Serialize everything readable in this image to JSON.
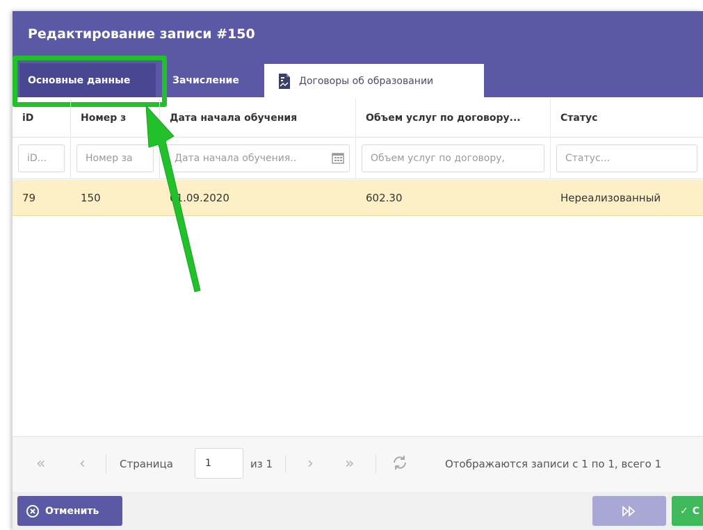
{
  "dialog": {
    "title": "Редактирование записи #150",
    "tabs": {
      "main": "Основные данные",
      "enrollment": "Зачисление",
      "contracts": "Договоры об образовании"
    }
  },
  "table": {
    "columns": [
      "iD",
      "Номер з",
      "Дата начала обучения",
      "Объем услуг по договору...",
      "Статус"
    ],
    "filters": {
      "id": "iD...",
      "number": "Номер за",
      "start_date": "Дата начала обучения..",
      "volume": "Объем услуг по договору,",
      "status": "Статус..."
    },
    "rows": [
      {
        "id": "79",
        "number": "150",
        "start_date": "01.09.2020",
        "volume": "602.30",
        "status": "Нереализованный"
      }
    ]
  },
  "pager": {
    "page_label": "Страница",
    "page_value": "1",
    "of_label": "из 1",
    "summary": "Отображаются записи с 1 по 1, всего 1"
  },
  "footer": {
    "cancel_label": "Отменить",
    "save_label": "С"
  },
  "colors": {
    "header": "#5b58a6",
    "highlight": "#22c02a",
    "selected_row": "#fdf0c7",
    "save": "#3fb95a"
  }
}
